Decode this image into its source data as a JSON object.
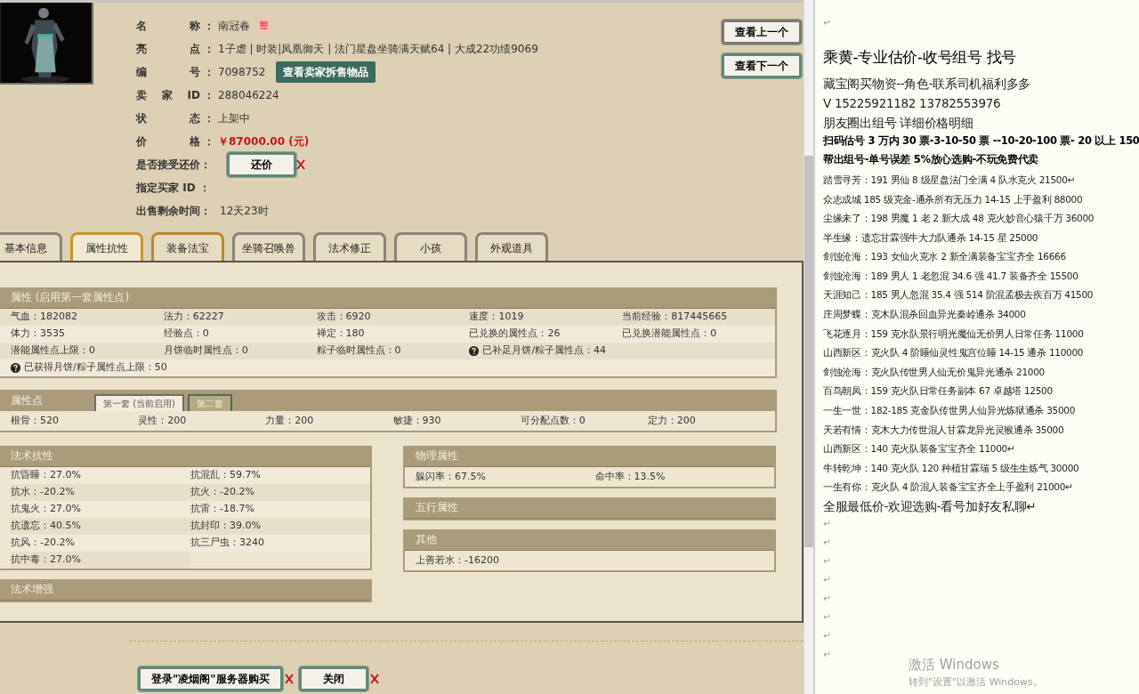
{
  "item_info": {
    "rows": [
      {
        "kind": "text",
        "label": "名称",
        "colon": "：",
        "value": "南冠春",
        "badge": "整"
      },
      {
        "kind": "text",
        "label": "亮点",
        "colon": "：",
        "value": "1子虐 | 时装|凤凰御天 | 法门星盘坐骑满天赋64 | 大成22功绩9069"
      },
      {
        "kind": "text",
        "label": "编号",
        "colon": "：",
        "value": "7098752",
        "button": "查看卖家拆售物品"
      },
      {
        "kind": "text",
        "label": "卖家ID",
        "colon": "：",
        "value": "288046224"
      },
      {
        "kind": "text",
        "label": "状态",
        "colon": "：",
        "value": "上架中"
      },
      {
        "kind": "price",
        "label": "价格",
        "colon": "：",
        "value": "￥87000.00 (元)"
      },
      {
        "kind": "free",
        "label": "是否接受还价：",
        "frame_button": "还价"
      },
      {
        "kind": "free",
        "label": "指定买家 ID ："
      },
      {
        "kind": "free",
        "label": "出售剩余时间：",
        "value": "12天23时"
      }
    ]
  },
  "nav_buttons": [
    "查看上一个",
    "查看下一个"
  ],
  "tabs": [
    {
      "label": "基本信息",
      "selected": false,
      "hovered": false
    },
    {
      "label": "属性抗性",
      "selected": true,
      "hovered": false
    },
    {
      "label": "装备法宝",
      "selected": false,
      "hovered": true
    },
    {
      "label": "坐骑召唤兽",
      "selected": false,
      "hovered": false
    },
    {
      "label": "法术修正",
      "selected": false,
      "hovered": false
    },
    {
      "label": "小孩",
      "selected": false,
      "hovered": false
    },
    {
      "label": "外观道具",
      "selected": false,
      "hovered": false
    }
  ],
  "attributes": {
    "title": "属性 (启用第一套属性点)",
    "rows": [
      [
        {
          "text": "气血：182082"
        },
        {
          "text": "法力：62227"
        },
        {
          "text": "攻击：6920"
        },
        {
          "text": "速度：1019"
        },
        {
          "text": "当前经验：817445665"
        }
      ],
      [
        {
          "text": "体力：3535"
        },
        {
          "text": "经验点：0"
        },
        {
          "text": "禅定：180"
        },
        {
          "text": "已兑换的属性点：26"
        },
        {
          "text": "已兑换潜能属性点：0"
        }
      ],
      [
        {
          "text": "潜能属性点上限：0"
        },
        {
          "text": "月饼临时属性点：0"
        },
        {
          "text": "粽子临时属性点：0"
        },
        {
          "text": "已补足月饼/粽子属性点：44",
          "help": true
        }
      ],
      [
        {
          "text": "已获得月饼/粽子属性点上限：50",
          "help": true
        }
      ]
    ]
  },
  "attribute_points": {
    "title": "属性点",
    "sets": [
      {
        "label": "第一套 (当前启用)",
        "selected": true
      },
      {
        "label": "第二套",
        "selected": false
      }
    ],
    "values": [
      "根骨：520",
      "灵性：200",
      "力量：200",
      "敏捷：930",
      "可分配点数：0",
      "定力：200"
    ]
  },
  "left_sections": [
    {
      "title": "法术抗性",
      "items": [
        "抗昏睡：27.0%",
        "抗混乱：59.7%",
        "抗水：-20.2%",
        "抗火：-20.2%",
        "抗鬼火：27.0%",
        "抗雷：-18.7%",
        "抗遗忘：40.5%",
        "抗封印：39.0%",
        "抗风：-20.2%",
        "抗三尸虫：3240",
        "抗中毒：27.0%"
      ]
    },
    {
      "title": "法术增强"
    }
  ],
  "right_sections": [
    {
      "title": "物理属性",
      "items": [
        "躲闪率：67.5%",
        "命中率：13.5%"
      ]
    },
    {
      "title": "五行属性"
    },
    {
      "title": "其他",
      "items": [
        "上善若水：-16200"
      ]
    }
  ],
  "bottom_buttons": [
    "登录\"凌烟阁\"服务器购买",
    "关闭"
  ],
  "document": {
    "lines": [
      {
        "kind": "mark",
        "text": "↵"
      },
      {
        "kind": "title",
        "text": "乘黄-专业估价-收号组号 找号"
      },
      {
        "kind": "large",
        "text": "藏宝阁买物资--角色-联系司机福利多多"
      },
      {
        "kind": "large",
        "text": "V 15225921182    13782553976"
      },
      {
        "kind": "large",
        "text": "朋友圈出组号    详细价格明细"
      },
      {
        "kind": "bold",
        "text": "扫码估号 3 万内 30 票-3-10-50 票  --10-20-100 票- 20 以上 150"
      },
      {
        "kind": "bold",
        "text": "帮出组号-单号误差 5%放心选购-不玩免费代卖"
      },
      {
        "kind": "normal",
        "text": "踏雪寻芳：191 男仙 8 级星盘法门全满 4 队水克火 21500↵"
      },
      {
        "kind": "normal",
        "text": "众志成城  185 级克金-通杀所有无压力 14-15 上手盈利 88000"
      },
      {
        "kind": "normal",
        "text": "尘缘未了：198 男魔 1 老 2 新大成 48 克火妙音心猿千万 36000"
      },
      {
        "kind": "normal",
        "text": "半生缘：遗忘甘霖强牛大力队通杀 14-15 星 25000"
      },
      {
        "kind": "normal",
        "text": "剑蚀沧海：193 女仙火克水 2 新全满装备宝宝齐全 16666"
      },
      {
        "kind": "normal",
        "text": "剑蚀沧海：189 男人 1 老忽混 34.6 强 41.7 装备齐全 15500"
      },
      {
        "kind": "normal",
        "text": "天涯知己：185 男人忽混 35.4 强 514 阶混孟极去疾百万 41500"
      },
      {
        "kind": "normal",
        "text": "庄周梦蝶：克木队混杀回血异光秦岭通杀 34000"
      },
      {
        "kind": "normal",
        "text": "飞花逐月：159 克水队景行明光魔仙无价男人日常任务 11000"
      },
      {
        "kind": "normal",
        "text": "山西新区：克火队 4 阶睡仙灵性鬼宫位睡 14-15 通杀 110000"
      },
      {
        "kind": "normal",
        "text": "剑蚀沧海：克火队传世男人仙无价鬼异光通杀 21000"
      },
      {
        "kind": "normal",
        "text": "百鸟朝凤：159 克火队日常任务副本 67 卓越塔 12500"
      },
      {
        "kind": "normal",
        "text": "一生一世：182-185 克金队传世男人仙异光炼狱通杀 35000"
      },
      {
        "kind": "normal",
        "text": "天若有情：克木大力传世混人甘霖龙异光灵猴通杀 35000"
      },
      {
        "kind": "normal",
        "text": "山西新区：140 克火队装备宝宝齐全 11000↵"
      },
      {
        "kind": "normal",
        "text": "牛转乾坤：140 克火队 120 种植甘霖瑞 5 级生生炼气 30000"
      },
      {
        "kind": "normal",
        "text": "一生有你：克火队 4 阶混人装备宝宝齐全上手盈利 21000↵"
      },
      {
        "kind": "large",
        "text": "全服最低价-欢迎选购-看号加好友私聊↵"
      },
      {
        "kind": "mark",
        "text": "↵"
      },
      {
        "kind": "mark",
        "text": "↵"
      },
      {
        "kind": "mark",
        "text": "↵"
      },
      {
        "kind": "mark",
        "text": "↵"
      },
      {
        "kind": "mark",
        "text": "↵"
      },
      {
        "kind": "mark",
        "text": "↵"
      },
      {
        "kind": "mark",
        "text": "↵"
      },
      {
        "kind": "mark",
        "text": "↵"
      }
    ]
  },
  "system_notice": {
    "title": "激活 Windows",
    "text": "转到\"设置\"以激活 Windows。"
  }
}
